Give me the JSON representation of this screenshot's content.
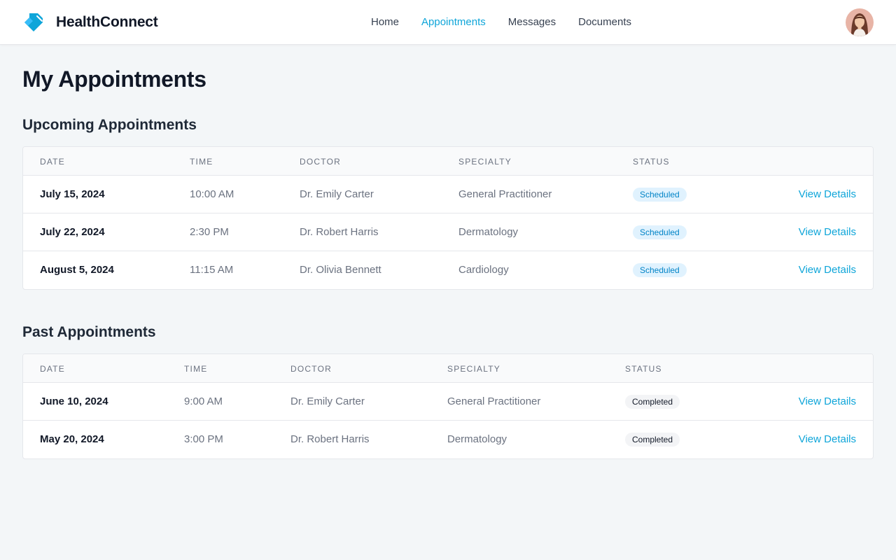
{
  "header": {
    "brand": "HealthConnect",
    "nav": [
      "Home",
      "Appointments",
      "Messages",
      "Documents"
    ],
    "active_nav": "Appointments",
    "accent_color": "#0ea5d9"
  },
  "page_title": "My Appointments",
  "upcoming": {
    "title": "Upcoming Appointments",
    "columns": [
      "DATE",
      "TIME",
      "DOCTOR",
      "SPECIALTY",
      "STATUS"
    ],
    "rows": [
      {
        "date": "July 15, 2024",
        "time": "10:00 AM",
        "doctor": "Dr. Emily Carter",
        "specialty": "General Practitioner",
        "status": "Scheduled",
        "action": "View Details"
      },
      {
        "date": "July 22, 2024",
        "time": "2:30 PM",
        "doctor": "Dr. Robert Harris",
        "specialty": "Dermatology",
        "status": "Scheduled",
        "action": "View Details"
      },
      {
        "date": "August 5, 2024",
        "time": "11:15 AM",
        "doctor": "Dr. Olivia Bennett",
        "specialty": "Cardiology",
        "status": "Scheduled",
        "action": "View Details"
      }
    ]
  },
  "past": {
    "title": "Past Appointments",
    "columns": [
      "DATE",
      "TIME",
      "DOCTOR",
      "SPECIALTY",
      "STATUS"
    ],
    "rows": [
      {
        "date": "June 10, 2024",
        "time": "9:00 AM",
        "doctor": "Dr. Emily Carter",
        "specialty": "General Practitioner",
        "status": "Completed",
        "action": "View Details"
      },
      {
        "date": "May 20, 2024",
        "time": "3:00 PM",
        "doctor": "Dr. Robert Harris",
        "specialty": "Dermatology",
        "status": "Completed",
        "action": "View Details"
      }
    ]
  },
  "icons": {
    "logo": "tag-logo-icon",
    "avatar": "user-avatar"
  }
}
